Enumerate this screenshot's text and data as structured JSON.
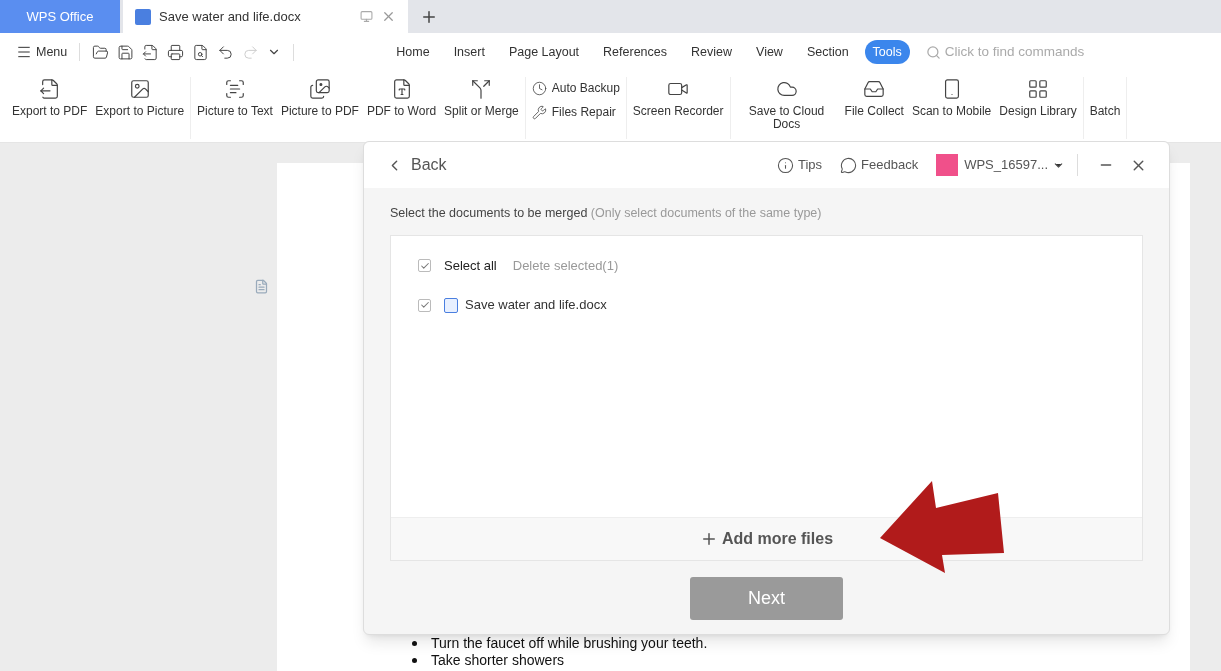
{
  "app_tab": {
    "label": "WPS Office"
  },
  "doc_tabs": [
    {
      "label": "Save water and life.docx",
      "selected": true
    }
  ],
  "menu_label": "Menu",
  "ribbon_tabs": [
    {
      "label": "Home",
      "selected": false
    },
    {
      "label": "Insert",
      "selected": false
    },
    {
      "label": "Page Layout",
      "selected": false
    },
    {
      "label": "References",
      "selected": false
    },
    {
      "label": "Review",
      "selected": false
    },
    {
      "label": "View",
      "selected": false
    },
    {
      "label": "Section",
      "selected": false
    },
    {
      "label": "Tools",
      "selected": true
    }
  ],
  "command_search": {
    "placeholder": "Click to find commands"
  },
  "ribbon_groups": [
    {
      "kind": "large",
      "items": [
        "Export to PDF",
        "Export to Picture"
      ]
    },
    {
      "kind": "large",
      "items": [
        "Picture to Text",
        "Picture to PDF",
        "PDF to Word",
        "Split or Merge"
      ]
    },
    {
      "kind": "stacked",
      "items": [
        "Auto Backup",
        "Files Repair"
      ]
    },
    {
      "kind": "large",
      "items": [
        "Screen Recorder"
      ]
    },
    {
      "kind": "large",
      "items": [
        "Save to Cloud Docs",
        "File Collect",
        "Scan to Mobile",
        "Design Library"
      ]
    },
    {
      "kind": "large",
      "items": [
        "Batch"
      ]
    }
  ],
  "dialog": {
    "back": "Back",
    "tips": "Tips",
    "feedback": "Feedback",
    "account": "WPS_16597...",
    "instruction": "Select the documents to be merged",
    "instruction_note": "(Only select documents of the same type)",
    "select_all": {
      "label": "Select all",
      "checked": true
    },
    "delete_selected": "Delete selected(1)",
    "files": [
      {
        "name": "Save water and life.docx",
        "checked": true
      }
    ],
    "add_more": "Add more files",
    "next": {
      "label": "Next",
      "disabled": true
    }
  },
  "document_bullets": [
    "Turn the faucet off while brushing your teeth.",
    "Take shorter showers"
  ]
}
